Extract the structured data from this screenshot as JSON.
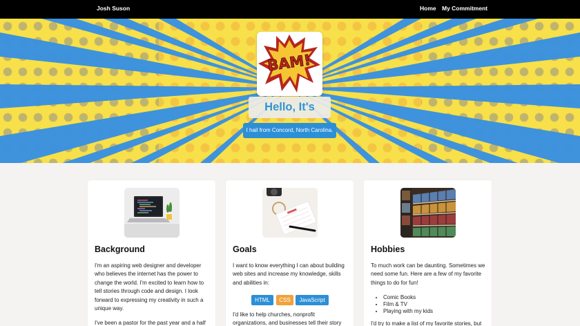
{
  "nav": {
    "brand": "Josh Suson",
    "links": [
      "Home",
      "My Commitment"
    ]
  },
  "hero": {
    "logo_text": "BAM!",
    "title": "Hello, It's Josh.",
    "subtitle": "I hail from Concord, North Carolina."
  },
  "cards": {
    "background": {
      "title": "Background",
      "text": "I'm an aspiring web designer and developer who believes the internet has the power to change the world. I'm excited to learn how to tell stories through code and design. I look forward to expressing my creativity in such a unique way.",
      "text2": "I've been a pastor for the past year and a half"
    },
    "goals": {
      "title": "Goals",
      "text": "I want to know everything I can about building web sites and increase my knowledge, skills and abilities in:",
      "tags": [
        "HTML",
        "CSS",
        "JavaScript"
      ],
      "text2": "I'd like to help churches, nonprofit organizations, and businesses tell their story"
    },
    "hobbies": {
      "title": "Hobbies",
      "text": "To much work can be daunting. Sometimes we need some fun. Here are a few of my favorite things to do for fun!",
      "list": [
        "Comic Books",
        "Film & TV",
        "Playing with my kids"
      ],
      "text2": "I'd try to make a list of my favorite stories, but"
    }
  },
  "colors": {
    "navbar": "#000000",
    "hero_yellow": "#f7e049",
    "hero_blue": "#2f95d6",
    "accent_blue": "#2d8fd5",
    "accent_orange": "#f0a23c",
    "page_bg": "#f4f3f1"
  },
  "icons": [
    "bam-comic-logo",
    "laptop-photo",
    "notebook-photo",
    "comic-shelf-photo"
  ]
}
